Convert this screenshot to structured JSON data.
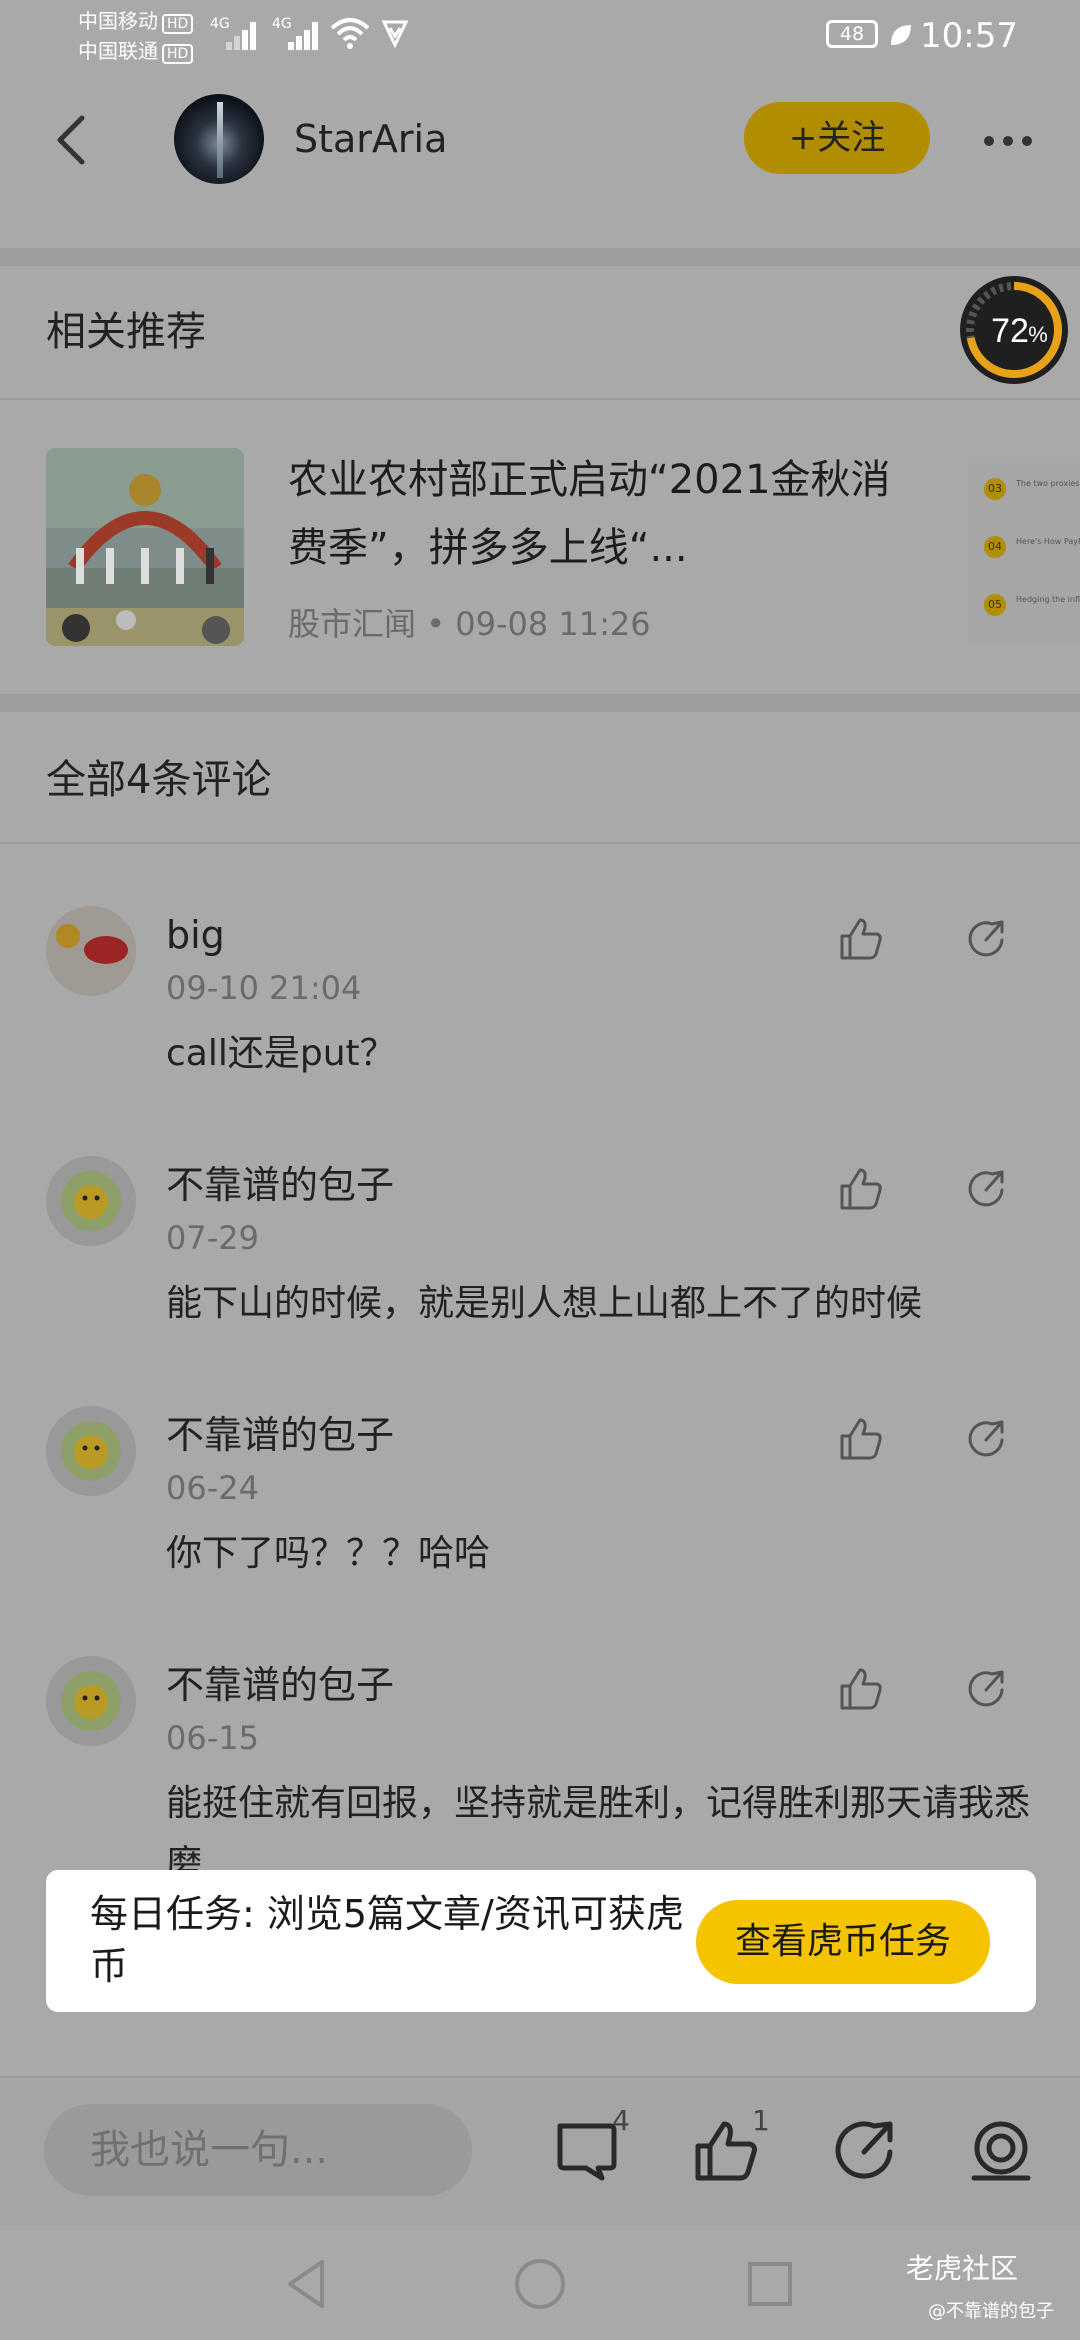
{
  "status_bar": {
    "carrier1": "中国移动",
    "carrier2": "中国联通",
    "hd": "HD",
    "net1": "4G",
    "net2": "4G",
    "battery": "48",
    "time": "10:57"
  },
  "header": {
    "username": "StarAria",
    "follow_label": "+关注"
  },
  "related": {
    "title": "相关推荐",
    "progress_text": "72",
    "progress_unit": "%",
    "progress_value": 0.72,
    "article": {
      "title": "农业农村部正式启动“2021金秋消费季”，拼多多上线“...",
      "source": "股市汇闻",
      "time": "09-08 11:26",
      "separator": "•"
    },
    "peek_items": [
      {
        "num": "03",
        "text": "The two proxies to sell"
      },
      {
        "num": "04",
        "text": "Here's How PayPal Can..."
      },
      {
        "num": "05",
        "text": "Hedging the inflation..."
      }
    ]
  },
  "comments_header": "全部4条评论",
  "comments": [
    {
      "name": "big",
      "date": "09-10 21:04",
      "text": "call还是put？"
    },
    {
      "name": "不靠谱的包子",
      "date": "07-29",
      "text": "能下山的时候，就是别人想上山都上不了的时候"
    },
    {
      "name": "不靠谱的包子",
      "date": "06-24",
      "text": "你下了吗？？？哈哈"
    },
    {
      "name": "不靠谱的包子",
      "date": "06-15",
      "text": "能挺住就有回报，坚持就是胜利，记得胜利那天请我悉磨"
    }
  ],
  "task_banner": {
    "text": "每日任务: 浏览5篇文章/资讯可获虎币",
    "button": "查看虎币任务"
  },
  "bottom_bar": {
    "input_placeholder": "我也说一句...",
    "comment_count": "4",
    "like_count": "1"
  },
  "watermark": {
    "brand": "老虎社区",
    "user": "@不靠谱的包子"
  },
  "colors": {
    "accent": "#f5c400",
    "dimmed_accent": "#b18d00",
    "overlay_bg": "#a9a9a9"
  }
}
